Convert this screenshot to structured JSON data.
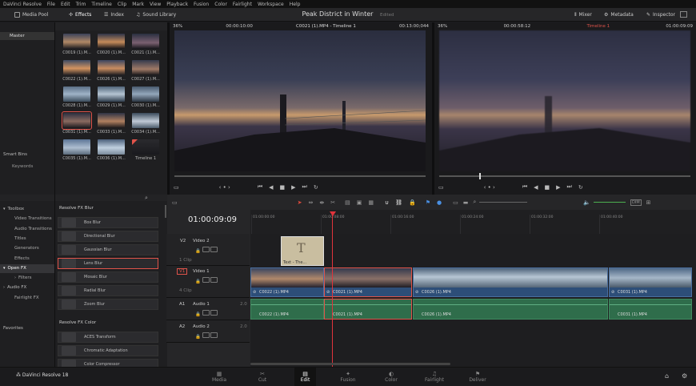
{
  "menu": [
    "DaVinci Resolve",
    "File",
    "Edit",
    "Trim",
    "Timeline",
    "Clip",
    "Mark",
    "View",
    "Playback",
    "Fusion",
    "Color",
    "Fairlight",
    "Workspace",
    "Help"
  ],
  "toolbar": {
    "media_pool": "Media Pool",
    "effects": "Effects",
    "index": "Index",
    "sound_library": "Sound Library",
    "project": "Peak District in Winter",
    "edited": "Edited",
    "mixer": "Mixer",
    "metadata": "Metadata",
    "inspector": "Inspector"
  },
  "source_viewer": {
    "zoom": "36%",
    "timecode": "00:00:10:00",
    "clip": "C0021 (1).MP4 - Timeline 1",
    "duration": "00:13:00;044"
  },
  "timeline_viewer": {
    "zoom": "36%",
    "timecode": "00:00:58:12",
    "timeline": "Timeline 1",
    "position": "01:00:09:09"
  },
  "bins": {
    "master": "Master",
    "smart_bins": "Smart Bins",
    "keywords": "Keywords"
  },
  "media": [
    "C0019 (1).M...",
    "C0020 (1).M...",
    "C0021 (1).M...",
    "C0022 (1).M...",
    "C0026 (1).M...",
    "C0027 (1).M...",
    "C0028 (1).M...",
    "C0029 (1).M...",
    "C0030 (1).M...",
    "C0031 (1).M...",
    "C0033 (1).M...",
    "C0034 (1).M...",
    "C0035 (1).M...",
    "C0036 (1).M...",
    "Timeline 1"
  ],
  "fx_tree": [
    "Toolbox",
    "Video Transitions",
    "Audio Transitions",
    "Titles",
    "Generators",
    "Effects",
    "Open FX",
    "Filters",
    "Audio FX",
    "Fairlight FX"
  ],
  "favorites": "Favorites",
  "fx_header": "Resolve FX Blur",
  "fx_items": [
    "Box Blur",
    "Directional Blur",
    "Gaussian Blur",
    "Lens Blur",
    "Mosaic Blur",
    "Radial Blur",
    "Zoom Blur"
  ],
  "fx_header2": "Resolve FX Color",
  "fx_items2": [
    "ACES Transform",
    "Chromatic Adaptation",
    "Color Compressor"
  ],
  "timeline": {
    "timecode": "01:00:09:09",
    "ruler": [
      "01:00:00:00",
      "01:00:08:00",
      "01:00:16:00",
      "01:00:24:00",
      "01:00:32:00",
      "01:00:40:00"
    ],
    "tracks": {
      "v2": "V2",
      "v2_name": "Video 2",
      "v1": "V1",
      "v1_name": "Video 1",
      "v1_count": "4 Clip",
      "v2_count": "1 Clip",
      "a1": "A1",
      "a1_name": "Audio 1",
      "a1_ch": "2.0",
      "a2": "A2",
      "a2_name": "Audio 2",
      "a2_ch": "2.0"
    },
    "title_clip": "Text - The...",
    "video_clips": [
      "C0022 (1).MP4",
      "C0021 (1).MP4",
      "C0026 (1).MP4",
      "C0031 (1).MP4"
    ],
    "audio_clips": [
      "C0022 (1).MP4",
      "C0021 (1).MP4",
      "C0026 (1).MP4",
      "C0031 (1).MP4"
    ]
  },
  "pages": [
    "Media",
    "Cut",
    "Edit",
    "Fusion",
    "Color",
    "Fairlight",
    "Deliver"
  ],
  "app_name": "DaVinci Resolve 18",
  "colors": {
    "accent": "#e64b3c",
    "clip_video": "#2d4e78",
    "clip_audio": "#2f6d4b",
    "playhead": "#e0343c"
  }
}
